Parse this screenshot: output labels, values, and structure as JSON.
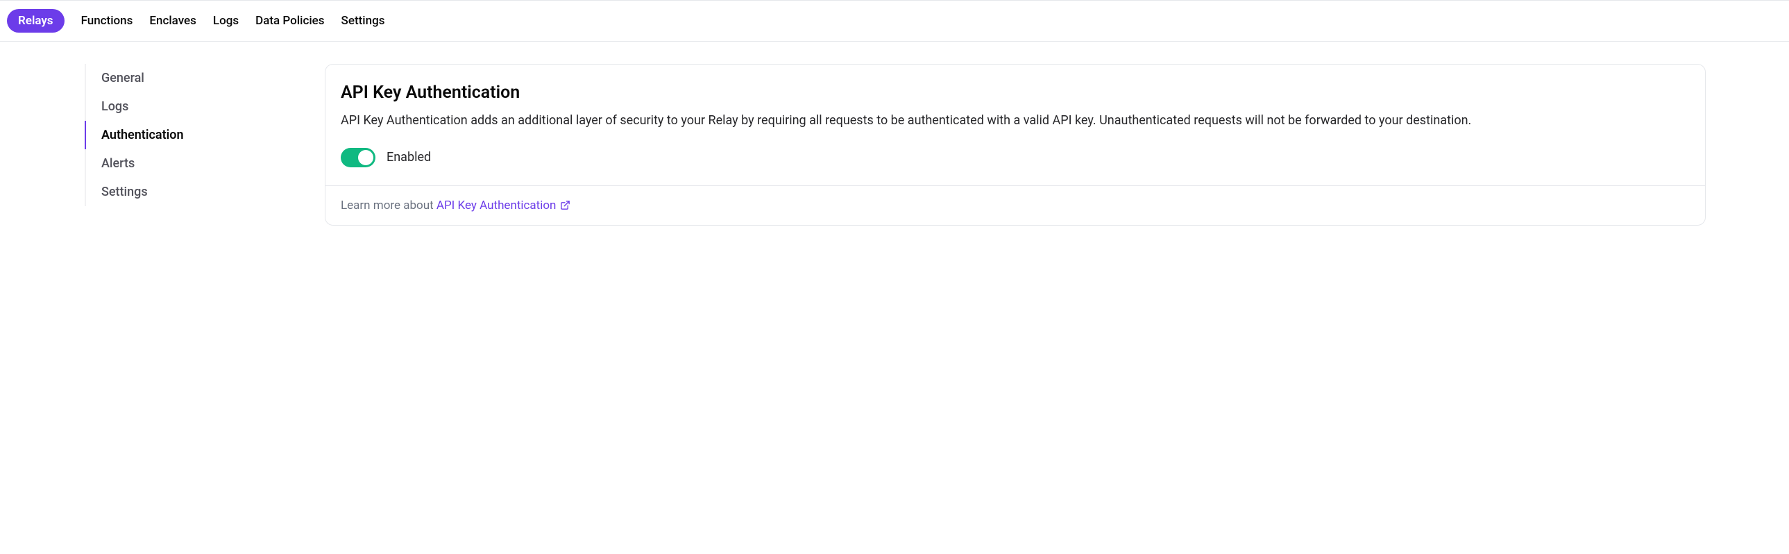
{
  "topnav": {
    "items": [
      {
        "label": "Relays",
        "active": true
      },
      {
        "label": "Functions",
        "active": false
      },
      {
        "label": "Enclaves",
        "active": false
      },
      {
        "label": "Logs",
        "active": false
      },
      {
        "label": "Data Policies",
        "active": false
      },
      {
        "label": "Settings",
        "active": false
      }
    ]
  },
  "sidenav": {
    "items": [
      {
        "label": "General",
        "active": false
      },
      {
        "label": "Logs",
        "active": false
      },
      {
        "label": "Authentication",
        "active": true
      },
      {
        "label": "Alerts",
        "active": false
      },
      {
        "label": "Settings",
        "active": false
      }
    ]
  },
  "card": {
    "title": "API Key Authentication",
    "description": "API Key Authentication adds an additional layer of security to your Relay by requiring all requests to be authenticated with a valid API key. Unauthenticated requests will not be forwarded to your destination.",
    "toggle": {
      "enabled": true,
      "label": "Enabled"
    },
    "footer": {
      "prefix": "Learn more about ",
      "link_text": "API Key Authentication"
    }
  }
}
